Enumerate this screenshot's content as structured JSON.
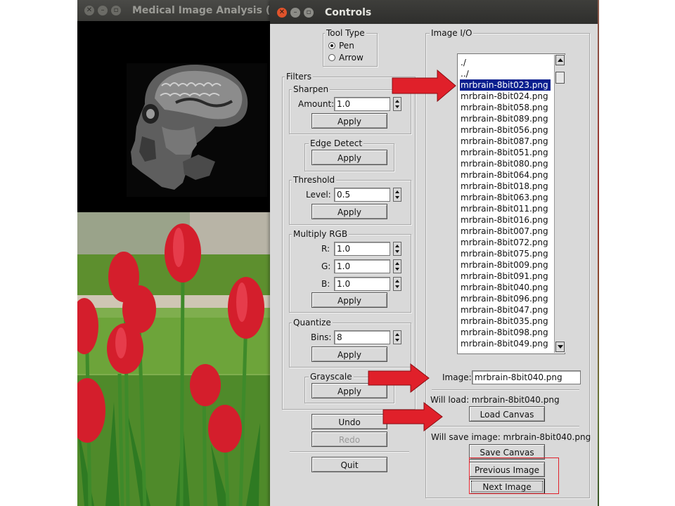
{
  "left_window": {
    "title": "Medical Image Analysis ("
  },
  "controls": {
    "title": "Controls",
    "tool_type": {
      "label": "Tool Type",
      "options": [
        "Pen",
        "Arrow"
      ],
      "selected": "Pen"
    },
    "filters": {
      "label": "Filters",
      "sharpen": {
        "label": "Sharpen",
        "amount_label": "Amount:",
        "amount": "1.0",
        "apply": "Apply"
      },
      "edge_detect": {
        "label": "Edge Detect",
        "apply": "Apply"
      },
      "threshold": {
        "label": "Threshold",
        "level_label": "Level:",
        "level": "0.5",
        "apply": "Apply"
      },
      "multiply_rgb": {
        "label": "Multiply RGB",
        "r_label": "R:",
        "r": "1.0",
        "g_label": "G:",
        "g": "1.0",
        "b_label": "B:",
        "b": "1.0",
        "apply": "Apply"
      },
      "quantize": {
        "label": "Quantize",
        "bins_label": "Bins:",
        "bins": "8",
        "apply": "Apply"
      },
      "grayscale": {
        "label": "Grayscale",
        "apply": "Apply"
      }
    },
    "undo": "Undo",
    "redo": "Redo",
    "quit": "Quit",
    "image_io": {
      "label": "Image I/O",
      "files": [
        "./",
        "../",
        "mrbrain-8bit023.png",
        "mrbrain-8bit024.png",
        "mrbrain-8bit058.png",
        "mrbrain-8bit089.png",
        "mrbrain-8bit056.png",
        "mrbrain-8bit087.png",
        "mrbrain-8bit051.png",
        "mrbrain-8bit080.png",
        "mrbrain-8bit064.png",
        "mrbrain-8bit018.png",
        "mrbrain-8bit063.png",
        "mrbrain-8bit011.png",
        "mrbrain-8bit016.png",
        "mrbrain-8bit007.png",
        "mrbrain-8bit072.png",
        "mrbrain-8bit075.png",
        "mrbrain-8bit009.png",
        "mrbrain-8bit091.png",
        "mrbrain-8bit040.png",
        "mrbrain-8bit096.png",
        "mrbrain-8bit047.png",
        "mrbrain-8bit035.png",
        "mrbrain-8bit098.png",
        "mrbrain-8bit049.png"
      ],
      "selected_file": "mrbrain-8bit023.png",
      "image_label": "Image:",
      "image_value": "mrbrain-8bit040.png",
      "will_load": "Will load: mrbrain-8bit040.png",
      "load_canvas": "Load Canvas",
      "will_save": "Will save image: mrbrain-8bit040.png",
      "save_canvas": "Save Canvas",
      "previous_image": "Previous Image",
      "next_image": "Next Image"
    }
  },
  "colors": {
    "panel_bg": "#d9d9d9",
    "selection": "#0a1f8f",
    "annotation_red": "#e0202a",
    "close_button": "#e0532b"
  }
}
